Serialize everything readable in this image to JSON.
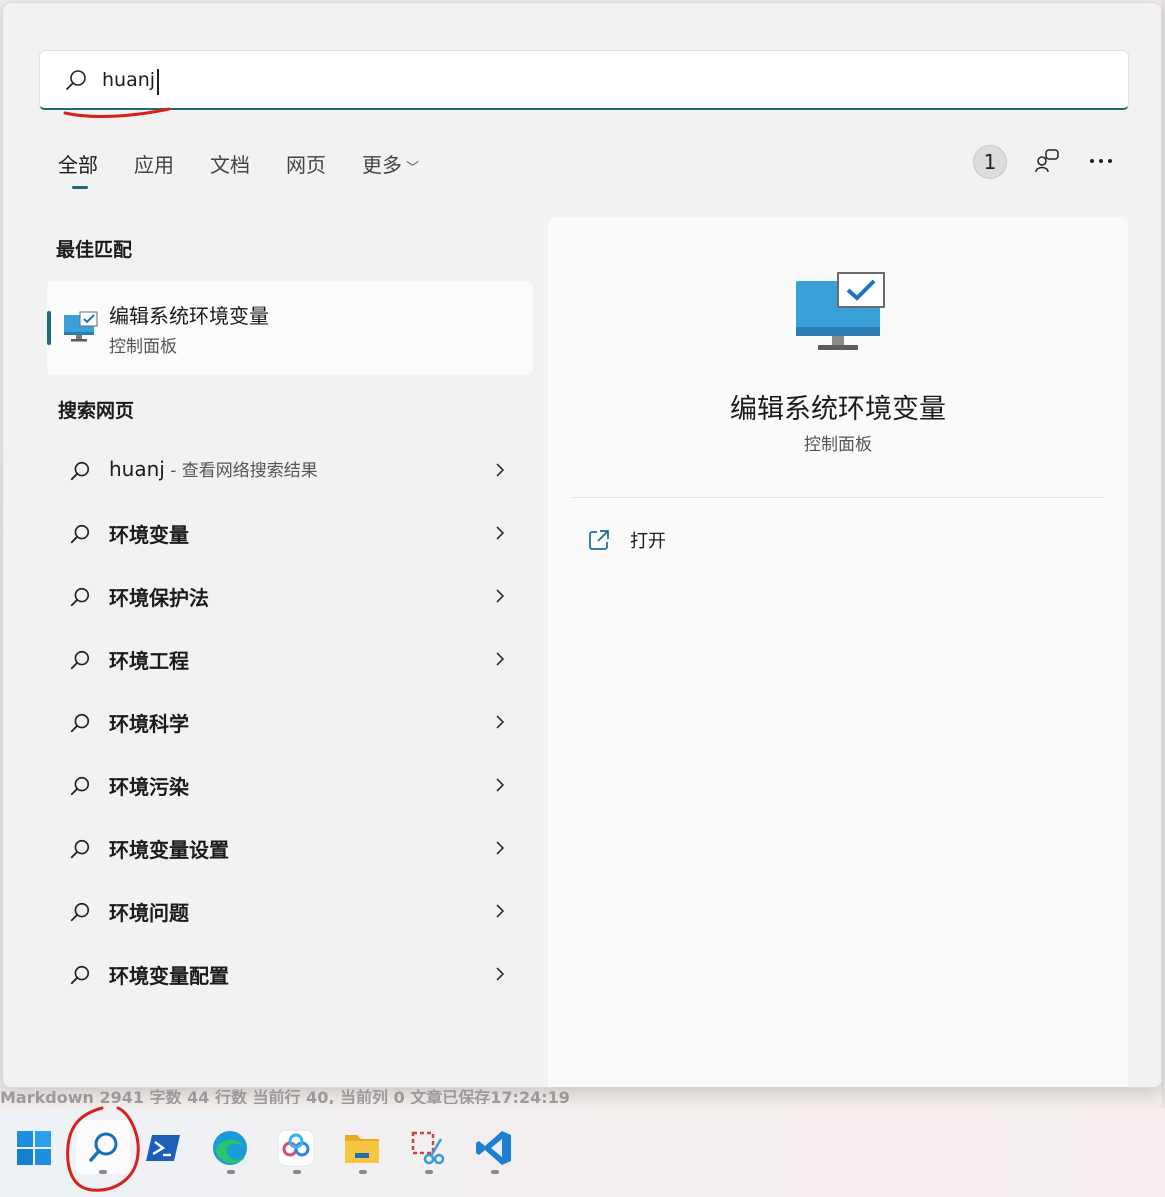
{
  "search": {
    "value": "huanj",
    "icon": "search-icon"
  },
  "tabs": [
    {
      "label": "全部",
      "active": true
    },
    {
      "label": "应用"
    },
    {
      "label": "文档"
    },
    {
      "label": "网页"
    },
    {
      "label": "更多"
    }
  ],
  "header_actions": {
    "badge": "1",
    "share_icon": "people-share-icon",
    "more_icon": "more-options-icon"
  },
  "best_match": {
    "section_title": "最佳匹配",
    "name": "编辑系统环境变量",
    "subtitle": "控制面板"
  },
  "web_search": {
    "section_title": "搜索网页",
    "items": [
      {
        "label": "huanj",
        "hint": " - 查看网络搜索结果"
      },
      {
        "label": "环境变量"
      },
      {
        "label": "环境保护法"
      },
      {
        "label": "环境工程"
      },
      {
        "label": "环境科学"
      },
      {
        "label": "环境污染"
      },
      {
        "label": "环境变量设置"
      },
      {
        "label": "环境问题"
      },
      {
        "label": "环境变量配置"
      }
    ]
  },
  "detail": {
    "title": "编辑系统环境变量",
    "subtitle": "控制面板",
    "actions": [
      {
        "label": "打开",
        "icon": "open-external-icon"
      }
    ]
  },
  "statusbar": {
    "text": "Markdown   2941 字数   44 行数   当前行 40, 当前列 0   文章已保存17:24:19"
  },
  "taskbar": {
    "items": [
      "start-icon",
      "search-icon",
      "powershell-icon",
      "edge-icon",
      "baidu-netdisk-icon",
      "file-explorer-icon",
      "snipping-tool-icon",
      "vscode-icon"
    ]
  },
  "colors": {
    "accent": "#1d6b73",
    "annotation_red": "#d9201c"
  }
}
